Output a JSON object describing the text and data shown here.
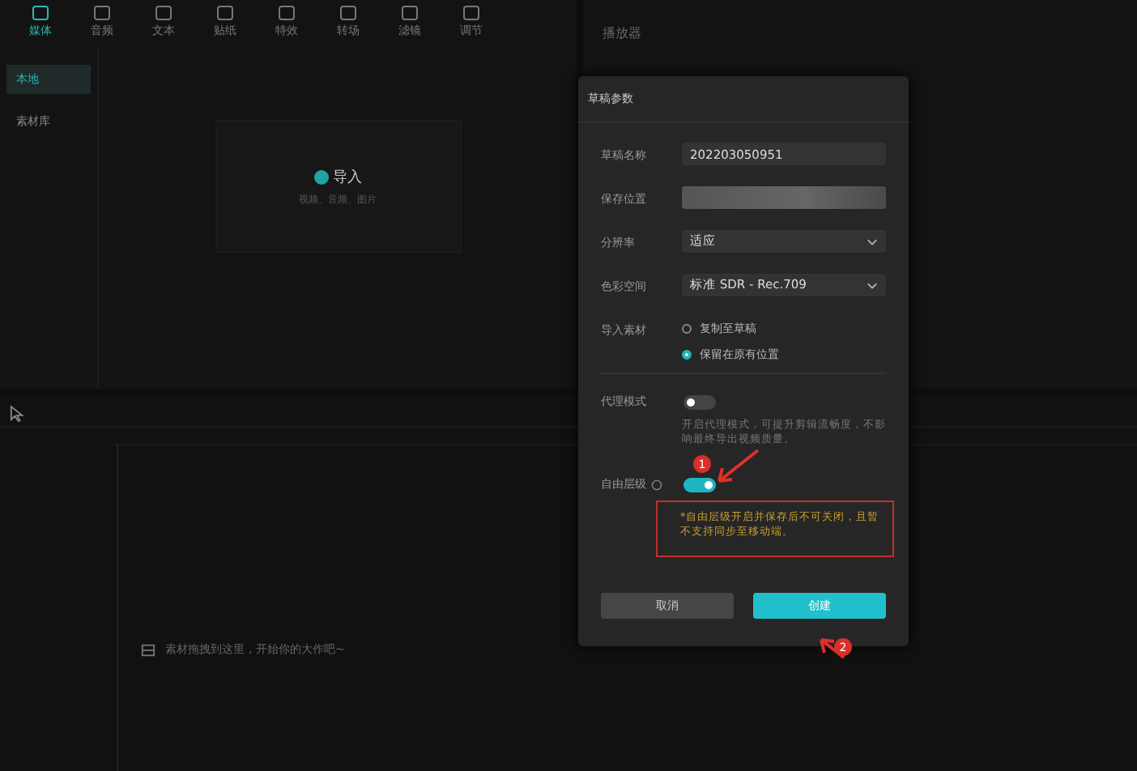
{
  "toolbar": {
    "items": [
      {
        "label": "媒体",
        "selected": true
      },
      {
        "label": "音频",
        "selected": false
      },
      {
        "label": "文本",
        "selected": false
      },
      {
        "label": "贴纸",
        "selected": false
      },
      {
        "label": "特效",
        "selected": false
      },
      {
        "label": "转场",
        "selected": false
      },
      {
        "label": "滤镜",
        "selected": false
      },
      {
        "label": "调节",
        "selected": false
      }
    ]
  },
  "sidebar": {
    "items": [
      {
        "label": "本地",
        "selected": true
      },
      {
        "label": "素材库",
        "selected": false
      }
    ]
  },
  "import_area": {
    "label": "导入",
    "hint": "视频、音频、图片"
  },
  "player": {
    "title": "播放器"
  },
  "timeline": {
    "hint": "素材拖拽到这里，开始你的大作吧~"
  },
  "dialog": {
    "title": "草稿参数",
    "fields": [
      {
        "kind": "text",
        "label": "草稿名称",
        "value": "202203050951"
      },
      {
        "kind": "blurred",
        "label": "保存位置"
      },
      {
        "kind": "select",
        "label": "分辨率",
        "value": "适应"
      },
      {
        "kind": "select",
        "label": "色彩空间",
        "value": "标准 SDR - Rec.709"
      },
      {
        "kind": "radio",
        "label": "导入素材",
        "options": [
          {
            "label": "复制至草稿",
            "selected": false
          },
          {
            "label": "保留在原有位置",
            "selected": true
          }
        ]
      }
    ],
    "toggles": [
      {
        "label": "代理模式",
        "on": false,
        "info": false,
        "note": "开启代理模式，可提升剪辑流畅度，不影响最终导出视频质量。",
        "warning": false
      },
      {
        "label": "自由层级",
        "on": true,
        "info": true,
        "note": "*自由层级开启并保存后不可关闭，且暂不支持同步至移动端。",
        "warning": true
      }
    ],
    "buttons": [
      {
        "label": "取消",
        "primary": false
      },
      {
        "label": "创建",
        "primary": true
      }
    ]
  },
  "annotations": [
    {
      "label": "1"
    },
    {
      "label": "2"
    }
  ]
}
